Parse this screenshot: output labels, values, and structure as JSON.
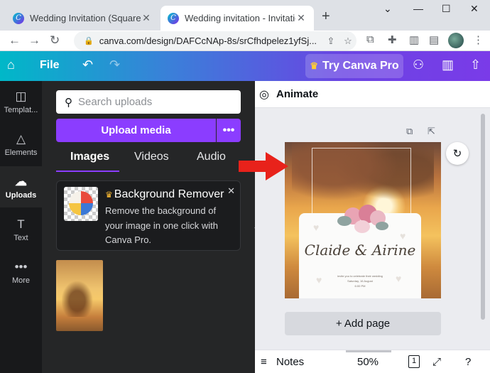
{
  "browser": {
    "tabs": [
      {
        "title": "Wedding Invitation (Square)",
        "active": false
      },
      {
        "title": "Wedding invitation - Invitation (",
        "active": true
      }
    ],
    "new_tab": "+",
    "window_controls": [
      "⌄",
      "—",
      "☐",
      "✕"
    ],
    "url": "canva.com/design/DAFCcNAp-8s/srCfhdpelez1yfSj...",
    "icons": [
      "back-icon",
      "forward-icon",
      "reload-icon",
      "lock-icon",
      "share-icon",
      "bookmark-star-icon",
      "extension-icon",
      "puzzle-icon",
      "sidepanel-icon",
      "profile-avatar"
    ]
  },
  "canva_header": {
    "file_label": "File",
    "try_pro_label": "Try Canva Pro",
    "icons": [
      "home-icon",
      "undo-icon",
      "redo-icon",
      "crown-icon",
      "share-people-icon",
      "analytics-icon",
      "upload-share-icon"
    ]
  },
  "rail": {
    "items": [
      {
        "label": "Templat...",
        "icon": "template-icon",
        "active": false
      },
      {
        "label": "Elements",
        "icon": "elements-icon",
        "active": false
      },
      {
        "label": "Uploads",
        "icon": "cloud-upload-icon",
        "active": true
      },
      {
        "label": "Text",
        "icon": "text-icon",
        "active": false
      },
      {
        "label": "More",
        "icon": "more-dots-icon",
        "active": false
      }
    ]
  },
  "panel": {
    "search_placeholder": "Search uploads",
    "upload_button": "Upload media",
    "more_button": "•••",
    "tabs": [
      {
        "label": "Images",
        "active": true
      },
      {
        "label": "Videos",
        "active": false
      },
      {
        "label": "Audio",
        "active": false
      }
    ],
    "promo": {
      "title": "Background Remover",
      "description": "Remove the background of your image in one click with Canva Pro."
    }
  },
  "editor": {
    "animate_label": "Animate",
    "design": {
      "names": "Claide & Airine",
      "line1": "invite you to celebrate their wedding",
      "line2": "Saturday, 16 August",
      "line3": "6:00 PM"
    },
    "add_page_label": "+ Add page",
    "notes_label": "Notes",
    "zoom": "50%",
    "page_count": "1"
  },
  "colors": {
    "canva_purple": "#8b3dff",
    "header_start": "#00b8c8",
    "header_end": "#7a3be8",
    "panel_bg": "#252627",
    "rail_bg": "#18191b",
    "arrow_red": "#e8221b"
  }
}
